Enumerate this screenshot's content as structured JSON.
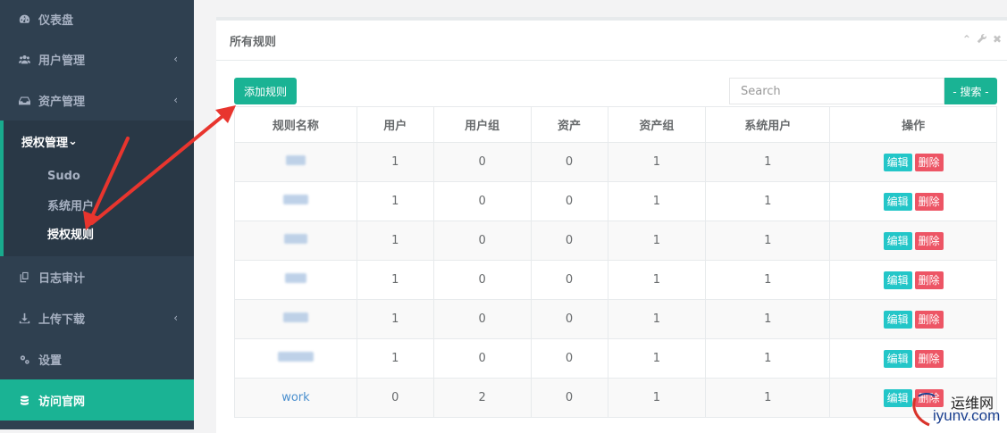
{
  "sidebar": {
    "items": [
      {
        "label": "仪表盘",
        "icon": "dashboard-icon"
      },
      {
        "label": "用户管理",
        "icon": "users-icon",
        "chevron": "‹"
      },
      {
        "label": "资产管理",
        "icon": "inbox-icon",
        "chevron": "‹"
      },
      {
        "label": "授权管理",
        "icon": "edit-icon",
        "chevron": "⌄",
        "subitems": [
          {
            "label": "Sudo"
          },
          {
            "label": "系统用户"
          },
          {
            "label": "授权规则"
          }
        ]
      },
      {
        "label": "日志审计",
        "icon": "copy-icon"
      },
      {
        "label": "上传下载",
        "icon": "download-icon",
        "chevron": "‹"
      },
      {
        "label": "设置",
        "icon": "gears-icon"
      },
      {
        "label": "访问官网",
        "icon": "database-icon"
      }
    ]
  },
  "panel": {
    "title": "所有规则",
    "add_label": "添加规则",
    "search_placeholder": "Search",
    "search_label": "- 搜索 -",
    "tools": {
      "collapse": "⌃",
      "wrench": "🔧",
      "close": "✖"
    }
  },
  "table": {
    "headers": [
      "规则名称",
      "用户",
      "用户组",
      "资产",
      "资产组",
      "系统用户",
      "操作"
    ],
    "rows": [
      {
        "name": "",
        "users": "1",
        "groups": "0",
        "assets": "0",
        "asset_groups": "1",
        "sys_users": "1"
      },
      {
        "name": "",
        "users": "1",
        "groups": "0",
        "assets": "0",
        "asset_groups": "1",
        "sys_users": "1"
      },
      {
        "name": "",
        "users": "1",
        "groups": "0",
        "assets": "0",
        "asset_groups": "1",
        "sys_users": "1"
      },
      {
        "name": "",
        "users": "1",
        "groups": "0",
        "assets": "0",
        "asset_groups": "1",
        "sys_users": "1"
      },
      {
        "name": "",
        "users": "1",
        "groups": "0",
        "assets": "0",
        "asset_groups": "1",
        "sys_users": "1"
      },
      {
        "name": "",
        "users": "1",
        "groups": "0",
        "assets": "0",
        "asset_groups": "1",
        "sys_users": "1"
      },
      {
        "name": "work",
        "users": "0",
        "groups": "2",
        "assets": "0",
        "asset_groups": "1",
        "sys_users": "1"
      }
    ],
    "edit_label": "编辑",
    "delete_label": "删除"
  },
  "watermark": {
    "top": "运维网",
    "bottom": "iyunv.com"
  },
  "colors": {
    "sidebar": "#2f4050",
    "accent": "#1ab394",
    "edit": "#23c6c8",
    "delete": "#ed5565",
    "arrow": "#e8352e"
  }
}
